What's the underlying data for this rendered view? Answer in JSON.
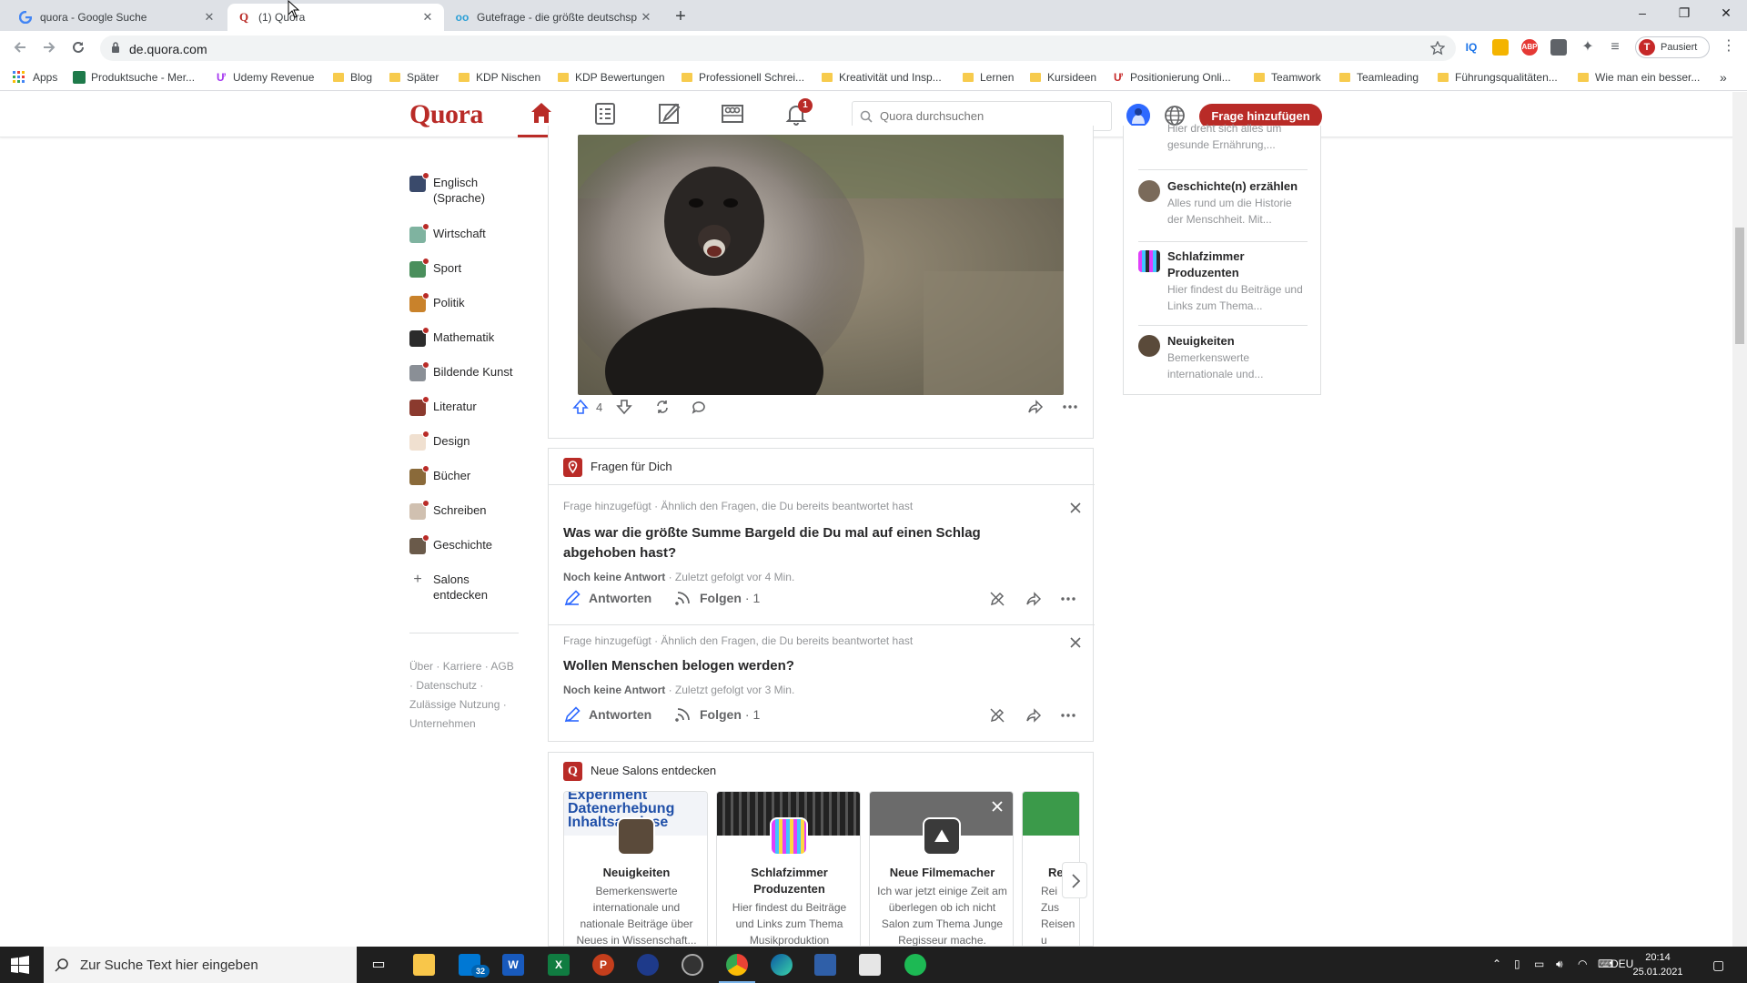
{
  "browser": {
    "tabs": [
      {
        "title": "quora - Google Suche",
        "favicon": "G"
      },
      {
        "title": "(1) Quora",
        "favicon": "Q"
      },
      {
        "title": "Gutefrage - die größte deutschsp",
        "favicon": "oo"
      }
    ],
    "new_tab": "+",
    "window_controls": [
      "–",
      "❐",
      "✕"
    ],
    "url": "de.quora.com",
    "profile_label": "Pausiert",
    "profile_initial": "T",
    "ext_labels": {
      "iq": "IQ",
      "abp": "ABP"
    },
    "bookmarks": [
      {
        "label": "Apps",
        "type": "apps"
      },
      {
        "label": "Produktsuche - Mer...",
        "type": "site"
      },
      {
        "label": "Udemy Revenue",
        "type": "site"
      },
      {
        "label": "Blog",
        "type": "folder"
      },
      {
        "label": "Später",
        "type": "folder"
      },
      {
        "label": "KDP Nischen",
        "type": "folder"
      },
      {
        "label": "KDP Bewertungen",
        "type": "folder"
      },
      {
        "label": "Professionell Schrei...",
        "type": "folder"
      },
      {
        "label": "Kreativität und Insp...",
        "type": "folder"
      },
      {
        "label": "Lernen",
        "type": "folder"
      },
      {
        "label": "Kursideen",
        "type": "folder"
      },
      {
        "label": "Positionierung Onli...",
        "type": "site"
      },
      {
        "label": "Teamwork",
        "type": "folder"
      },
      {
        "label": "Teamleading",
        "type": "folder"
      },
      {
        "label": "Führungsqualitäten...",
        "type": "folder"
      },
      {
        "label": "Wie man ein besser...",
        "type": "folder"
      }
    ],
    "bookmarks_more": "»"
  },
  "quora": {
    "logo": "Quora",
    "notification_count": "1",
    "search_placeholder": "Quora durchsuchen",
    "add_question": "Frage hinzufügen",
    "accent": "#b92b27",
    "sidebar": [
      {
        "label": "Englisch (Sprache)",
        "color": "#3a4a6b"
      },
      {
        "label": "Wirtschaft",
        "color": "#7fb3a0"
      },
      {
        "label": "Sport",
        "color": "#4a8f5c"
      },
      {
        "label": "Politik",
        "color": "#c9822b"
      },
      {
        "label": "Mathematik",
        "color": "#2b2b2b"
      },
      {
        "label": "Bildende Kunst",
        "color": "#8a8f96"
      },
      {
        "label": "Literatur",
        "color": "#8b3a2e"
      },
      {
        "label": "Design",
        "color": "#f0e0d0"
      },
      {
        "label": "Bücher",
        "color": "#8a6a3a"
      },
      {
        "label": "Schreiben",
        "color": "#d0c0b0"
      },
      {
        "label": "Geschichte",
        "color": "#6a5a4a"
      }
    ],
    "salons_discover": "Salons entdecken",
    "footer_links": [
      "Über",
      "Karriere",
      "AGB",
      "Datenschutz",
      "Zulässige Nutzung",
      "Unternehmen"
    ],
    "post": {
      "upvotes": "4"
    },
    "fragen_header": "Fragen für Dich",
    "questions": [
      {
        "meta": "Frage hinzugefügt · Ähnlich den Fragen, die Du bereits beantwortet hast",
        "title": "Was war die größte Summe Bargeld die Du mal auf einen Schlag abgehoben hast?",
        "status": "Noch keine Antwort",
        "followed": "· Zuletzt gefolgt vor 4 Min.",
        "answer": "Antworten",
        "follow": "Folgen",
        "follow_count": "· 1"
      },
      {
        "meta": "Frage hinzugefügt · Ähnlich den Fragen, die Du bereits beantwortet hast",
        "title": "Wollen Menschen belogen werden?",
        "status": "Noch keine Antwort",
        "followed": "· Zuletzt gefolgt vor 3 Min.",
        "answer": "Antworten",
        "follow": "Folgen",
        "follow_count": "· 1"
      }
    ],
    "salons_header": "Neue Salons entdecken",
    "salons": [
      {
        "title": "Neuigkeiten",
        "desc": "Bemerkenswerte internationale und nationale Beiträge über Neues in Wissenschaft..."
      },
      {
        "title": "Schlafzimmer Produzenten",
        "desc": "Hier findest du Beiträge und Links zum Thema Musikproduktion"
      },
      {
        "title": "Neue Filmemacher",
        "desc": "Ich war jetzt einige Zeit am überlegen ob ich nicht Salon zum Thema Junge Regisseur mache."
      },
      {
        "title": "Reise",
        "desc": "Rei Zus Reisen u"
      }
    ],
    "banner_text": "Experiment Datenerhebung Inhaltsanalyse",
    "right_sidebar": [
      {
        "title": "",
        "desc": "Hier dreht sich alles um gesunde Ernährung,..."
      },
      {
        "title": "Geschichte(n) erzählen",
        "desc": "Alles rund um die Historie der Menschheit. Mit..."
      },
      {
        "title": "Schlafzimmer Produzenten",
        "desc": "Hier findest du Beiträge und Links zum Thema..."
      },
      {
        "title": "Neuigkeiten",
        "desc": "Bemerkenswerte internationale und..."
      }
    ]
  },
  "taskbar": {
    "search_placeholder": "Zur Suche Text hier eingeben",
    "mail_badge": "32",
    "lang": "DEU",
    "time": "20:14",
    "date": "25.01.2021"
  }
}
